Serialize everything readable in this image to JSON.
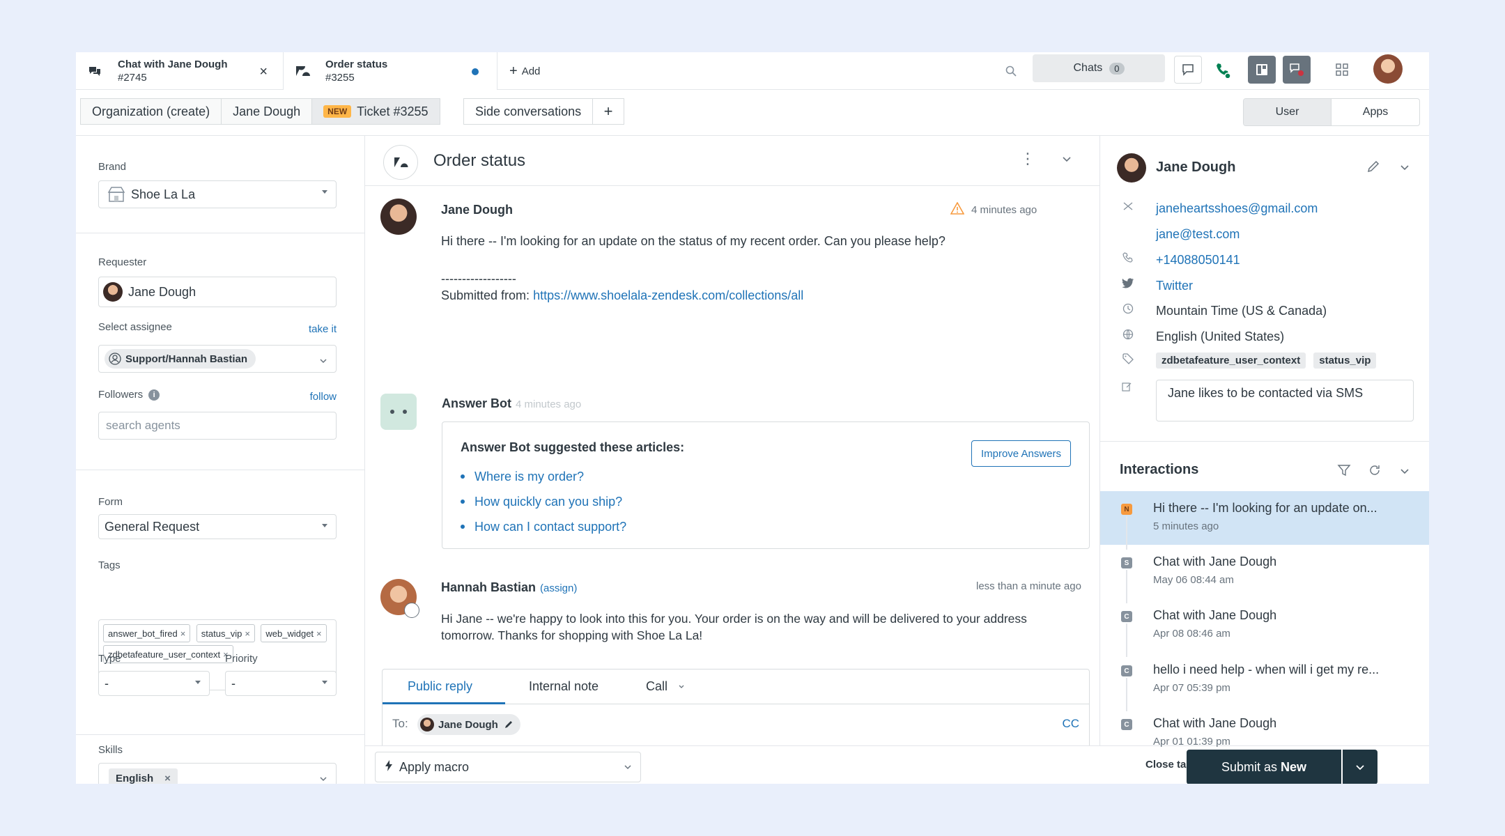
{
  "tabs": [
    {
      "title": "Chat with Jane Dough",
      "sub": "#2745"
    },
    {
      "title": "Order status",
      "sub": "#3255"
    }
  ],
  "add_tab": "Add",
  "chats": {
    "label": "Chats",
    "count": "0"
  },
  "breadcrumbs": {
    "org": "Organization (create)",
    "user": "Jane Dough",
    "ticket_badge": "NEW",
    "ticket": "Ticket #3255",
    "side": "Side conversations",
    "plus": "+"
  },
  "segment": {
    "user": "User",
    "apps": "Apps"
  },
  "left": {
    "brand_label": "Brand",
    "brand_value": "Shoe La La",
    "requester_label": "Requester",
    "requester_value": "Jane Dough",
    "assignee_label": "Select assignee",
    "take_it": "take it",
    "assignee_value": "Support/Hannah Bastian",
    "followers_label": "Followers",
    "follow": "follow",
    "followers_placeholder": "search agents",
    "form_label": "Form",
    "form_value": "General Request",
    "tags_label": "Tags",
    "tags": [
      "answer_bot_fired",
      "status_vip",
      "web_widget",
      "zdbetafeature_user_context"
    ],
    "type_label": "Type",
    "type_value": "-",
    "priority_label": "Priority",
    "priority_value": "-",
    "skills_label": "Skills",
    "skills_value": "English"
  },
  "conversation": {
    "title": "Order status",
    "msg1": {
      "name": "Jane Dough",
      "time": "4 minutes ago",
      "text": "Hi there -- I'm looking for an update on the status of my recent order. Can you please help?",
      "sep": "------------------",
      "submitted_label": "Submitted from:",
      "submitted_url": "https://www.shoelala-zendesk.com/collections/all"
    },
    "bot": {
      "name": "Answer Bot",
      "time": "4 minutes ago",
      "heading": "Answer Bot suggested these articles:",
      "improve": "Improve Answers",
      "articles": [
        "Where is my order?",
        "How quickly can you ship?",
        "How can I contact support?"
      ]
    },
    "msg2": {
      "name": "Hannah Bastian",
      "assign": "(assign)",
      "time": "less than a minute ago",
      "text1": "Hi Jane -- we're happy to look into this for you. Your order is on the way and will be delivered to your address",
      "text2": "tomorrow. Thanks for shopping with Shoe La La!"
    }
  },
  "composer": {
    "tab_public": "Public reply",
    "tab_internal": "Internal note",
    "tab_call": "Call",
    "to_label": "To:",
    "to_name": "Jane Dough",
    "cc": "CC"
  },
  "bottom": {
    "macro": "Apply macro",
    "close_tab": "Close tab",
    "submit_prefix": "Submit as",
    "submit_status": "New"
  },
  "user_panel": {
    "name": "Jane Dough",
    "email1": "janeheartsshoes@gmail.com",
    "email2": "jane@test.com",
    "phone": "+14088050141",
    "twitter": "Twitter",
    "timezone": "Mountain Time (US & Canada)",
    "language": "English (United States)",
    "tags": [
      "zdbetafeature_user_context",
      "status_vip"
    ],
    "notes": "Jane likes to be contacted via SMS"
  },
  "interactions": {
    "title": "Interactions",
    "items": [
      {
        "badge": "N",
        "title": "Hi there -- I'm looking for an update on...",
        "time": "5 minutes ago"
      },
      {
        "badge": "S",
        "title": "Chat with Jane Dough",
        "time": "May 06 08:44 am"
      },
      {
        "badge": "C",
        "title": "Chat with Jane Dough",
        "time": "Apr 08 08:46 am"
      },
      {
        "badge": "C",
        "title": "hello i need help - when will i get my re...",
        "time": "Apr 07 05:39 pm"
      },
      {
        "badge": "C",
        "title": "Chat with Jane Dough",
        "time": "Apr 01 01:39 pm"
      }
    ]
  },
  "colors": {
    "accent": "#1f73b7",
    "submit_bg": "#1f3540",
    "selected_row": "#d1e4f5",
    "page_bg": "#e9effb"
  }
}
